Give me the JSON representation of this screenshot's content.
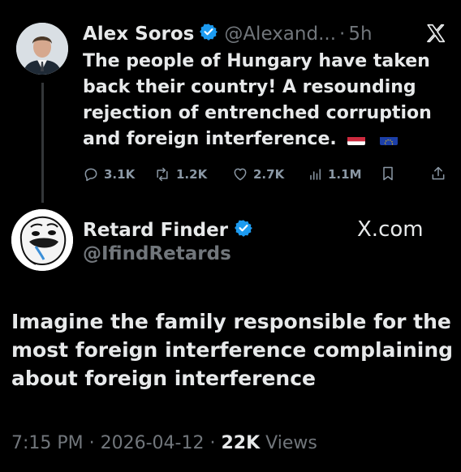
{
  "quoted_tweet": {
    "author_name": "Alex Soros",
    "handle": "@Alexand...",
    "separator": "·",
    "time": "5h",
    "text": "The people of Hungary have taken back their country! A resounding rejection of entrenched corruption and foreign interference.",
    "flags": [
      "hungary-flag-icon",
      "eu-flag-icon"
    ],
    "close_icon": "x-logo-icon",
    "stats": {
      "replies": "3.1K",
      "reposts": "1.2K",
      "likes": "2.7K",
      "views": "1.1M"
    }
  },
  "main_tweet": {
    "author_name": "Retard Finder",
    "handle": "@IfindRetards",
    "site_label": "X.com",
    "text": "Imagine the family responsible for the most foreign interference complaining about foreign interference",
    "timestamp": "7:15 PM · 2026-04-12 · ",
    "views_count": "22K",
    "views_label": " Views"
  },
  "colors": {
    "background": "#000000",
    "text": "#e7e9ea",
    "muted": "#71767b",
    "verified": "#1d9bf0"
  }
}
